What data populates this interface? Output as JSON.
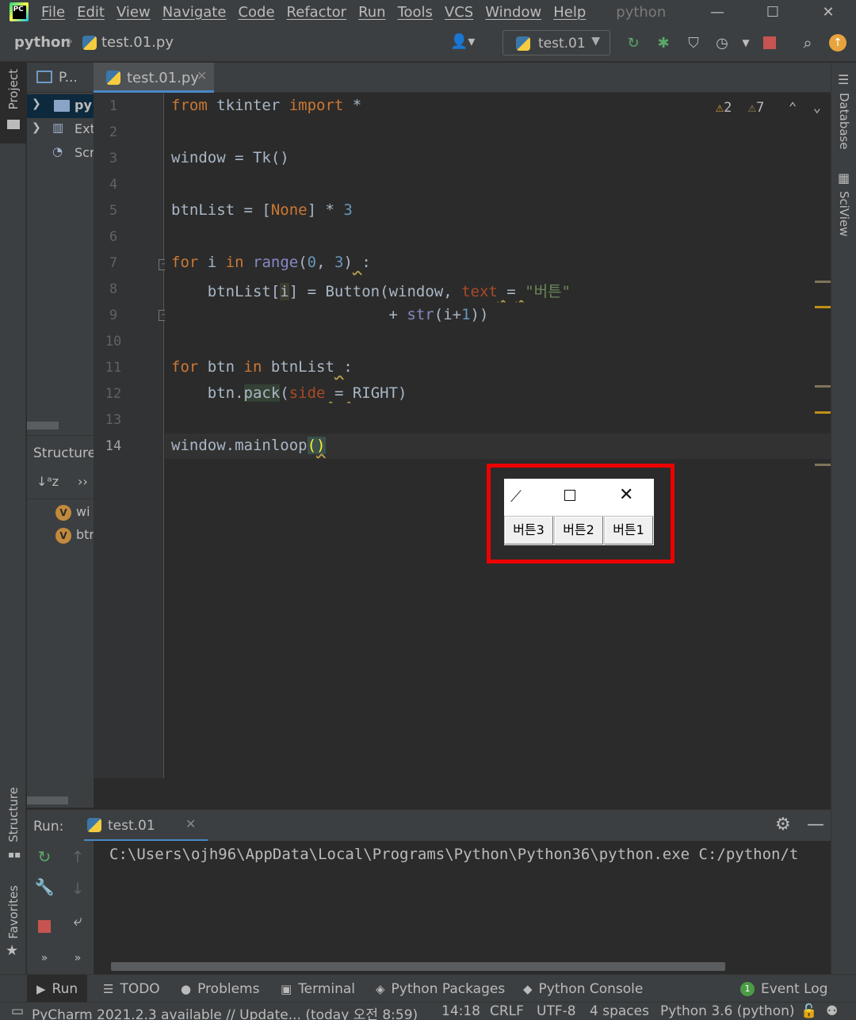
{
  "menu": {
    "logo_text": "PC",
    "items": [
      "File",
      "Edit",
      "View",
      "Navigate",
      "Code",
      "Refactor",
      "Run",
      "Tools",
      "VCS",
      "Window",
      "Help"
    ],
    "window_title": "python"
  },
  "navbar": {
    "project": "python",
    "file": "test.01.py",
    "run_config": "test.01"
  },
  "left_strip": {
    "project_tab": "Project",
    "structure_tab": "Structure",
    "favorites_tab": "Favorites"
  },
  "project_panel": {
    "header": "P...",
    "items": [
      "py",
      "Ext",
      "Scr"
    ]
  },
  "structure_panel": {
    "title": "Structure",
    "items": [
      "wi",
      "btr"
    ],
    "badge": "V"
  },
  "editor": {
    "tab_label": "test.01.py",
    "inspections": {
      "warnings": "2",
      "weak_warnings": "7"
    },
    "line_numbers": [
      "1",
      "2",
      "3",
      "4",
      "5",
      "6",
      "7",
      "8",
      "9",
      "10",
      "11",
      "12",
      "13",
      "14"
    ]
  },
  "tk_window": {
    "buttons": [
      "버튼3",
      "버튼2",
      "버튼1"
    ]
  },
  "right_strip": {
    "database": "Database",
    "sciview": "SciView"
  },
  "run_panel": {
    "label": "Run:",
    "tab": "test.01",
    "output": "C:\\Users\\ojh96\\AppData\\Local\\Programs\\Python\\Python36\\python.exe C:/python/t"
  },
  "tool_tabs": [
    "Run",
    "TODO",
    "Problems",
    "Terminal",
    "Python Packages",
    "Python Console",
    "Event Log"
  ],
  "status": {
    "update": "PyCharm 2021.2.3 available // Update... (today 오전 8:59)",
    "position": "14:18",
    "line_sep": "CRLF",
    "encoding": "UTF-8",
    "indent": "4 spaces",
    "interpreter": "Python 3.6 (python)"
  },
  "colors": {
    "accent": "#4a88c7",
    "keyword": "#cc7832",
    "number": "#6897bb",
    "string": "#6a8759",
    "run_green": "#59a869",
    "stop_red": "#c75450",
    "highlight_red": "#ee0000"
  }
}
